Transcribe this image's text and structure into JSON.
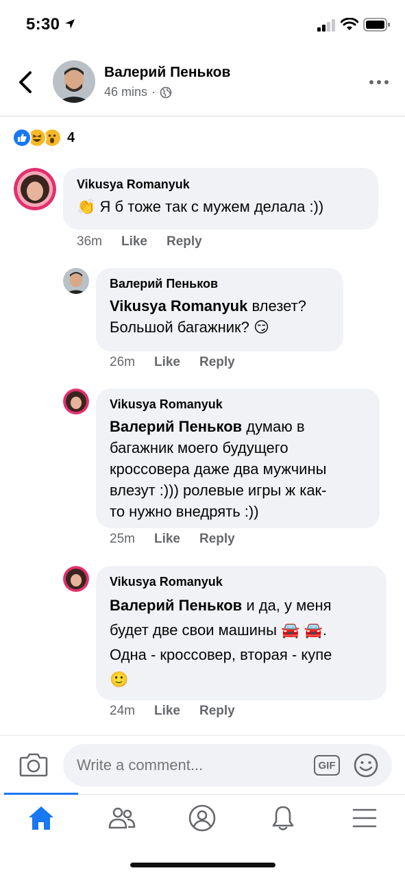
{
  "status_bar": {
    "time": "5:30"
  },
  "header": {
    "name": "Валерий Пеньков",
    "time_ago": "46 mins",
    "separator": "·"
  },
  "reactions": {
    "count": "4",
    "types": [
      "like",
      "haha",
      "wow"
    ]
  },
  "comments": [
    {
      "author": "Vikusya Romanyuk",
      "emoji": "👏",
      "text": "Я б тоже так с мужем делала :))",
      "time": "36m",
      "like_label": "Like",
      "reply_label": "Reply"
    },
    {
      "author": "Валерий Пеньков",
      "mention": "Vikusya Romanyuk",
      "text": "влезет?",
      "text2": "Большой багажник?",
      "emoji": "😏",
      "time": "26m",
      "like_label": "Like",
      "reply_label": "Reply"
    },
    {
      "author": "Vikusya Romanyuk",
      "mention": "Валерий Пеньков",
      "line1": "думаю в",
      "line2": "багажник моего будущего",
      "line3": "кроссовера даже два мужчины",
      "line4": "влезут :))) ролевые игры ж как-",
      "line5": "то нужно внедрять :))",
      "time": "25m",
      "like_label": "Like",
      "reply_label": "Reply"
    },
    {
      "author": "Vikusya Romanyuk",
      "mention": "Валерий Пеньков",
      "line1": "и да, у меня",
      "line2": "будет две свои машины",
      "cars": "🚘 🚘",
      "line2_end": ".",
      "line3": "Одна - кроссовер, вторая - купе",
      "emoji": "🙂",
      "time": "24m",
      "like_label": "Like",
      "reply_label": "Reply"
    }
  ],
  "composer": {
    "placeholder": "Write a comment...",
    "gif_label": "GIF"
  },
  "tabs": [
    "home-icon",
    "friends-icon",
    "profile-icon",
    "notifications-icon",
    "menu-icon"
  ],
  "colors": {
    "accent": "#1877f2",
    "bubble": "#f0f2f5",
    "secondary_text": "#65676b"
  }
}
